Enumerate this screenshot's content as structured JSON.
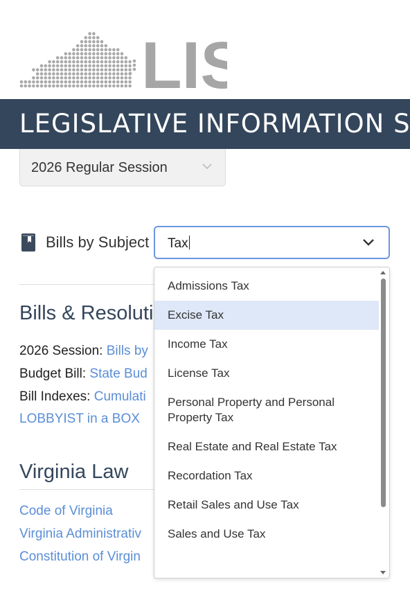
{
  "logo": {
    "text": "LIS"
  },
  "banner": {
    "title": "LEGISLATIVE INFORMATION SYSTEM"
  },
  "session": {
    "selected": "2026 Regular Session"
  },
  "subject_filter": {
    "label": "Bills by Subject",
    "value": "Tax"
  },
  "dropdown": {
    "options": [
      "Admissions Tax",
      "Excise Tax",
      "Income Tax",
      "License Tax",
      "Personal Property and Personal Property Tax",
      "Real Estate and Real Estate Tax",
      "Recordation Tax",
      "Retail Sales and Use Tax",
      "Sales and Use Tax"
    ],
    "highlighted_index": 1
  },
  "bills_section": {
    "heading": "Bills & Resoluti",
    "session_label": "2026 Session:",
    "session_link": "Bills by",
    "budget_label": "Budget Bill:",
    "budget_link": "State Bud",
    "indexes_label": "Bill Indexes:",
    "indexes_link": "Cumulati",
    "lobbyist_link": "LOBBYIST in a BOX"
  },
  "virginia_law": {
    "heading": "Virginia Law",
    "links": [
      "Code of Virginia",
      "Virginia Administrativ",
      "Constitution of Virgin"
    ]
  },
  "colors": {
    "banner": "#34465c",
    "link": "#5a8ed6",
    "highlight": "#dfe8f8",
    "input_border": "#6a96e0"
  }
}
